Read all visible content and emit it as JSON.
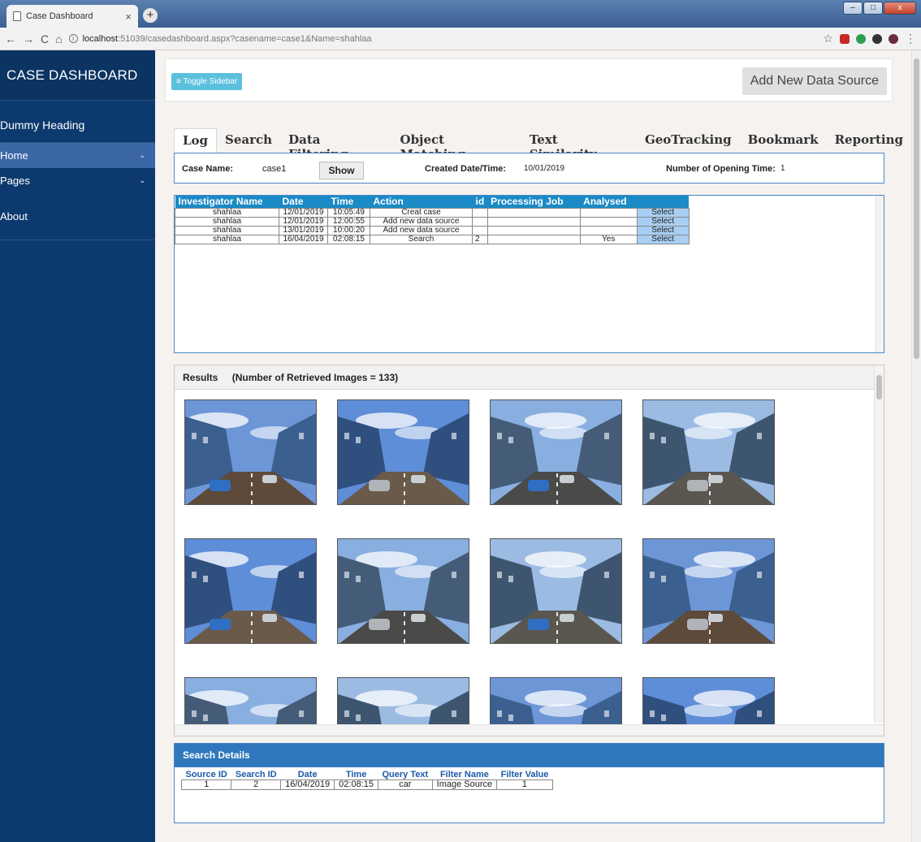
{
  "browser": {
    "tab_title": "Case Dashboard",
    "tab_close": "×",
    "new_tab": "+",
    "url_host": "localhost",
    "url_path": ":51039/casedashboard.aspx?casename=case1&Name=shahlaa",
    "nav_back": "←",
    "nav_forward": "→",
    "nav_reload": "C",
    "nav_home": "⌂",
    "bookmark_star": "☆",
    "menu_dots": "⋮",
    "win_min": "–",
    "win_max": "□",
    "win_close": "x"
  },
  "sidebar": {
    "brand": "CASE DASHBOARD",
    "heading": "Dummy Heading",
    "items": [
      {
        "label": "Home",
        "icon": "chevron-down-icon",
        "active": true
      },
      {
        "label": "Pages",
        "icon": "chevron-down-icon",
        "active": false
      }
    ],
    "about": "About"
  },
  "topbar": {
    "toggle_label": "Toggle Sidebar",
    "add_source_label": "Add New Data Source"
  },
  "tabs": [
    "Log",
    "Search",
    "Data Filtering",
    "Object Matching",
    "Text Similarity",
    "GeoTracking",
    "Bookmark",
    "Reporting"
  ],
  "case": {
    "name_label": "Case Name:",
    "name_value": "case1",
    "show_label": "Show",
    "created_label": "Created Date/Time:",
    "created_value": "10/01/2019",
    "openings_label": "Number of Opening Time:",
    "openings_value": "1"
  },
  "log": {
    "columns": [
      "Investigator Name",
      "Date",
      "Time",
      "Action",
      "id",
      "Processing Job",
      "Analysed",
      ""
    ],
    "rows": [
      [
        "shahlaa",
        "12/01/2019",
        "10:05:49",
        "Creat case",
        "",
        "",
        "",
        "Select"
      ],
      [
        "shahlaa",
        "12/01/2019",
        "12:00:55",
        "Add new data source",
        "",
        "",
        "",
        "Select"
      ],
      [
        "shahlaa",
        "13/01/2019",
        "10:00:20",
        "Add new data source",
        "",
        "",
        "",
        "Select"
      ],
      [
        "shahlaa",
        "16/04/2019",
        "02:08:15",
        "Search",
        "2",
        "",
        "Yes",
        "Select"
      ]
    ]
  },
  "results": {
    "title": "Results",
    "count_text": "(Number of Retrieved Images = 133)"
  },
  "details": {
    "title": "Search Details",
    "columns": [
      "Source ID",
      "Search ID",
      "Date",
      "Time",
      "Query Text",
      "Filter Name",
      "Filter Value"
    ],
    "rows": [
      [
        "1",
        "2",
        "16/04/2019",
        "02:08:15",
        "car",
        "Image Source",
        "1"
      ]
    ]
  },
  "colors": {
    "sidebar": "#0d3a6e",
    "sidebar_active": "#3b67a6",
    "table_header": "#1a8bc6",
    "panel_header": "#2f78bd",
    "toggle_button": "#5bc0de",
    "select_cell": "#a8cff3"
  }
}
